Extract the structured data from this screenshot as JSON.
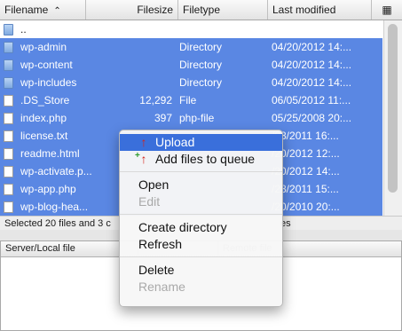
{
  "file_list": {
    "columns": {
      "filename": "Filename",
      "filesize": "Filesize",
      "filetype": "Filetype",
      "modified": "Last modified"
    },
    "rows": [
      {
        "name": "..",
        "size": "",
        "type": "",
        "modified": "",
        "icon": "folder-icon",
        "selected": false
      },
      {
        "name": "wp-admin",
        "size": "",
        "type": "Directory",
        "modified": "04/20/2012 14:...",
        "icon": "folder-icon",
        "selected": true
      },
      {
        "name": "wp-content",
        "size": "",
        "type": "Directory",
        "modified": "04/20/2012 14:...",
        "icon": "folder-icon",
        "selected": true
      },
      {
        "name": "wp-includes",
        "size": "",
        "type": "Directory",
        "modified": "04/20/2012 14:...",
        "icon": "folder-icon",
        "selected": true
      },
      {
        "name": ".DS_Store",
        "size": "12,292",
        "type": "File",
        "modified": "06/05/2012 11:...",
        "icon": "file-icon",
        "selected": true
      },
      {
        "name": "index.php",
        "size": "397",
        "type": "php-file",
        "modified": "05/25/2008 20:...",
        "icon": "file-icon",
        "selected": true
      },
      {
        "name": "license.txt",
        "size": "",
        "type": "",
        "modified": "/08/2011 16:...",
        "icon": "file-icon",
        "selected": true
      },
      {
        "name": "readme.html",
        "size": "",
        "type": "",
        "modified": "/20/2012 12:...",
        "icon": "file-icon",
        "selected": true
      },
      {
        "name": "wp-activate.p...",
        "size": "",
        "type": "",
        "modified": "/20/2012 14:...",
        "icon": "file-icon",
        "selected": true
      },
      {
        "name": "wp-app.php",
        "size": "",
        "type": "",
        "modified": "/28/2011 15:...",
        "icon": "file-icon",
        "selected": true
      },
      {
        "name": "wp-blog-hea...",
        "size": "",
        "type": "",
        "modified": "/20/2010 20:...",
        "icon": "file-icon",
        "selected": true
      }
    ],
    "status_left": "Selected 20 files and 3 c",
    "status_right": "es"
  },
  "queue": {
    "columns": {
      "server": "Server/Local file",
      "dir": "",
      "remote": "Remote file"
    }
  },
  "context_menu": {
    "items": [
      {
        "label": "Upload",
        "icon": "upload-icon",
        "highlighted": true,
        "disabled": false
      },
      {
        "label": "Add files to queue",
        "icon": "add-to-queue-icon",
        "highlighted": false,
        "disabled": false
      },
      {
        "separator": true
      },
      {
        "label": "Open",
        "highlighted": false,
        "disabled": false
      },
      {
        "label": "Edit",
        "highlighted": false,
        "disabled": true
      },
      {
        "separator": true
      },
      {
        "label": "Create directory",
        "highlighted": false,
        "disabled": false
      },
      {
        "label": "Refresh",
        "highlighted": false,
        "disabled": false
      },
      {
        "separator": true
      },
      {
        "label": "Delete",
        "highlighted": false,
        "disabled": false
      },
      {
        "label": "Rename",
        "highlighted": false,
        "disabled": true
      }
    ]
  },
  "colors": {
    "selection": "#5a87e3",
    "menu_highlight": "#3a6fdb"
  }
}
